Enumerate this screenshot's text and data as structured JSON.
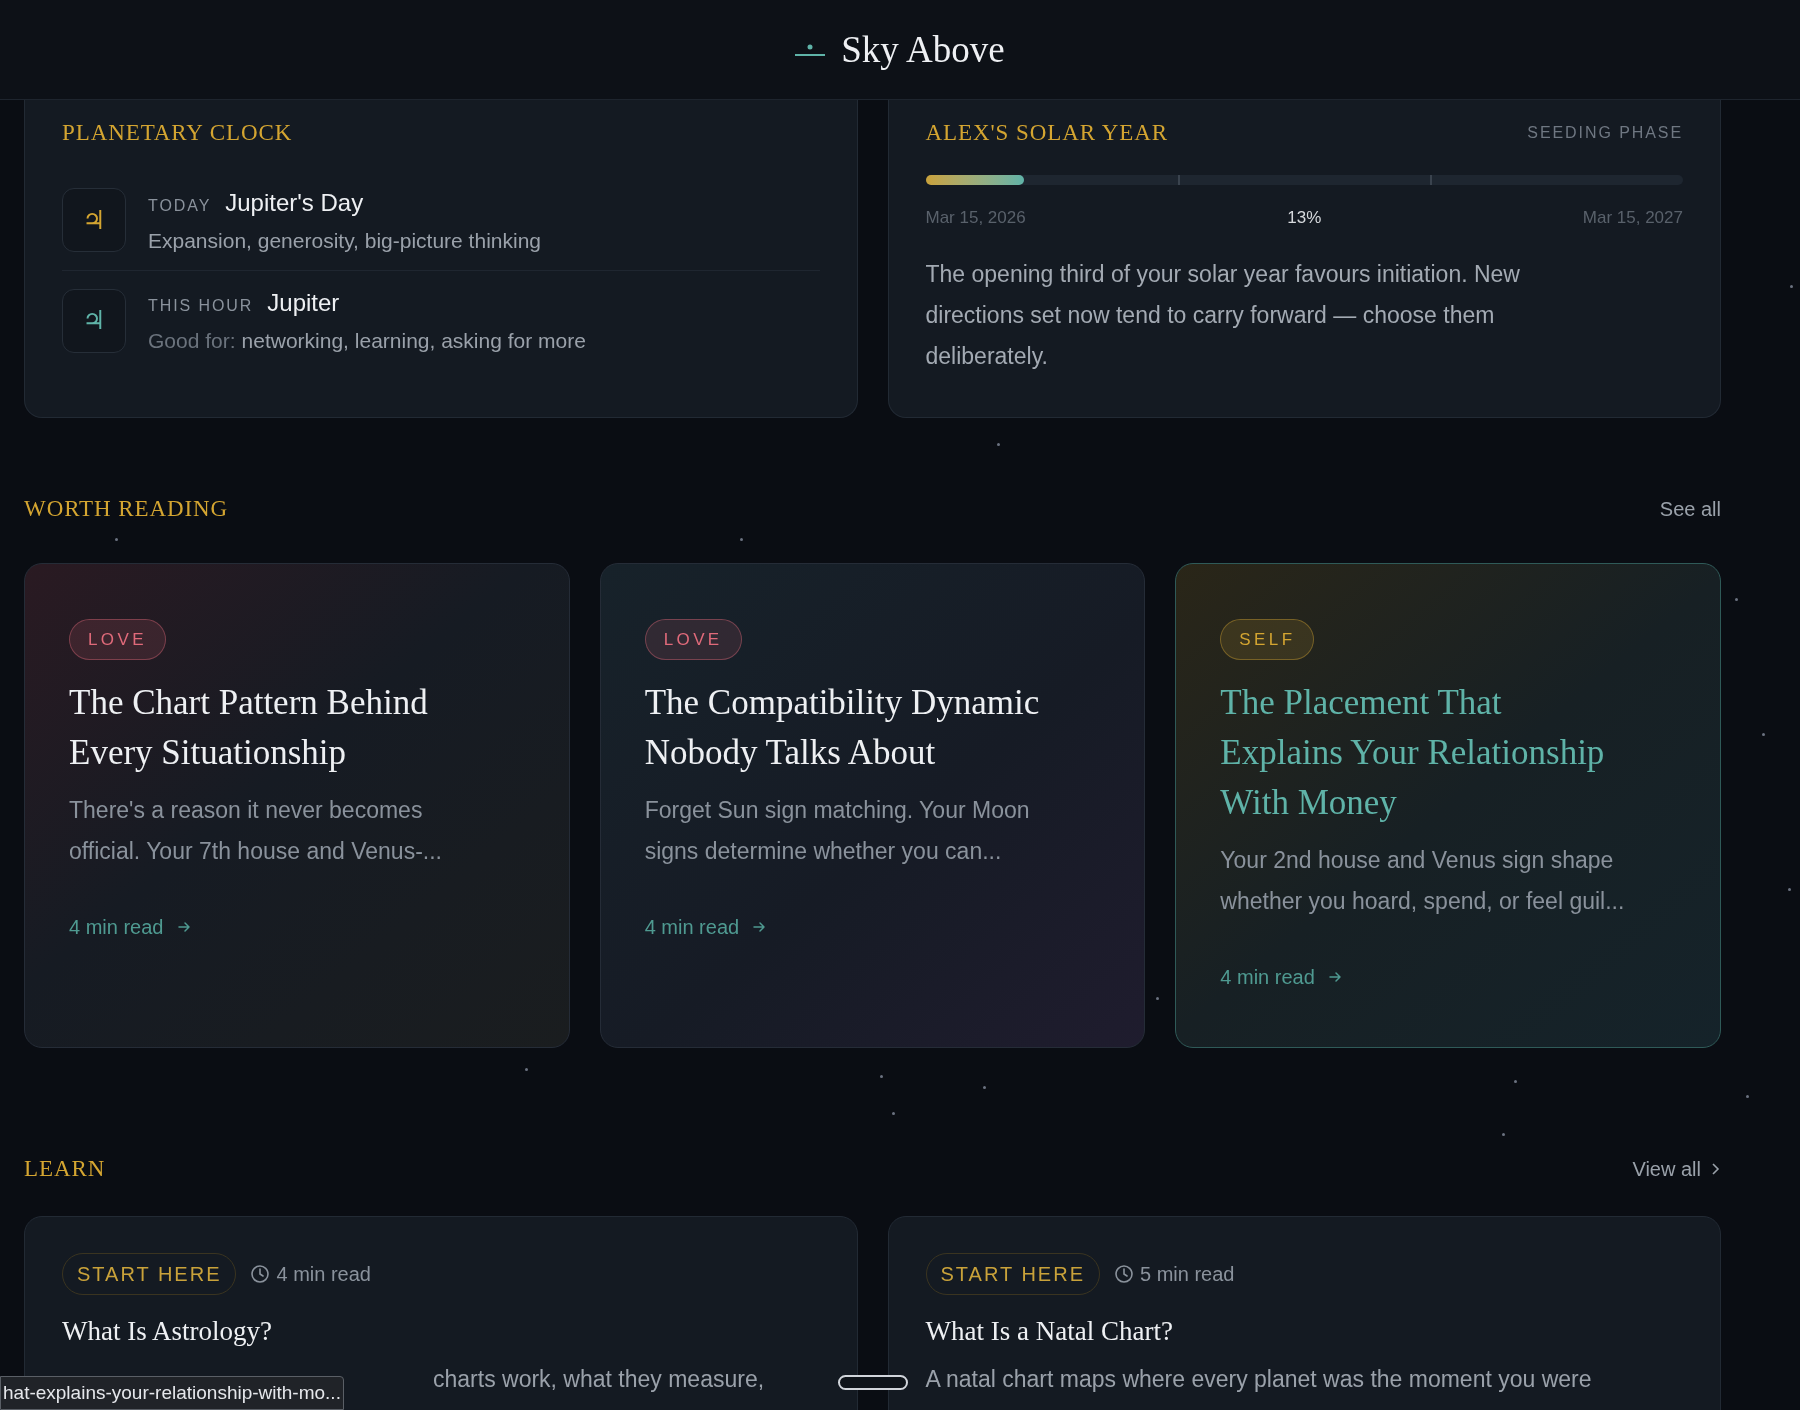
{
  "header": {
    "title": "Sky Above"
  },
  "planetary_clock": {
    "title": "PLANETARY CLOCK",
    "rows": [
      {
        "glyph": "♃",
        "color": "#d4a531",
        "label": "TODAY",
        "name": "Jupiter's Day",
        "prefix": "",
        "detail": "Expansion, generosity, big-picture thinking"
      },
      {
        "glyph": "♃",
        "color": "#5fb3a8",
        "label": "THIS HOUR",
        "name": "Jupiter",
        "prefix": "Good for:",
        "detail": "networking, learning, asking for more"
      }
    ]
  },
  "solar_year": {
    "title": "ALEX'S SOLAR YEAR",
    "phase": "SEEDING PHASE",
    "level": 0.13,
    "start": "Mar 15, 2026",
    "percent": "13%",
    "end": "Mar 15, 2027",
    "text": "The opening third of your solar year favours initiation. New directions set now tend to carry forward — choose them deliberately."
  },
  "worth_reading": {
    "title": "WORTH READING",
    "link": "See all",
    "articles": [
      {
        "tag": "LOVE",
        "color": "#e06a7a",
        "title": "The Chart Pattern Behind Every Situationship",
        "summary": "There's a reason it never becomes official. Your 7th house and Venus-...",
        "read": "4 min read",
        "selected": false
      },
      {
        "tag": "LOVE",
        "color": "#e06a7a",
        "title": "The Compatibility Dynamic Nobody Talks About",
        "summary": "Forget Sun sign matching. Your Moon signs determine whether you can...",
        "read": "4 min read",
        "selected": false
      },
      {
        "tag": "SELF",
        "color": "#d4a531",
        "title": "The Placement That Explains Your Relationship With Money",
        "summary": "Your 2nd house and Venus sign shape whether you hoard, spend, or feel guil...",
        "read": "4 min read",
        "selected": true
      }
    ]
  },
  "learn": {
    "title": "LEARN",
    "link": "View all",
    "cards": [
      {
        "tag": "START HERE",
        "read": "4 min read",
        "title": "What Is Astrology?",
        "summary": "charts work, what they measure,"
      },
      {
        "tag": "START HERE",
        "read": "5 min read",
        "title": "What Is a Natal Chart?",
        "summary": "A natal chart maps where every planet was the moment you were"
      }
    ]
  },
  "status_bar": "hat-explains-your-relationship-with-mo..."
}
